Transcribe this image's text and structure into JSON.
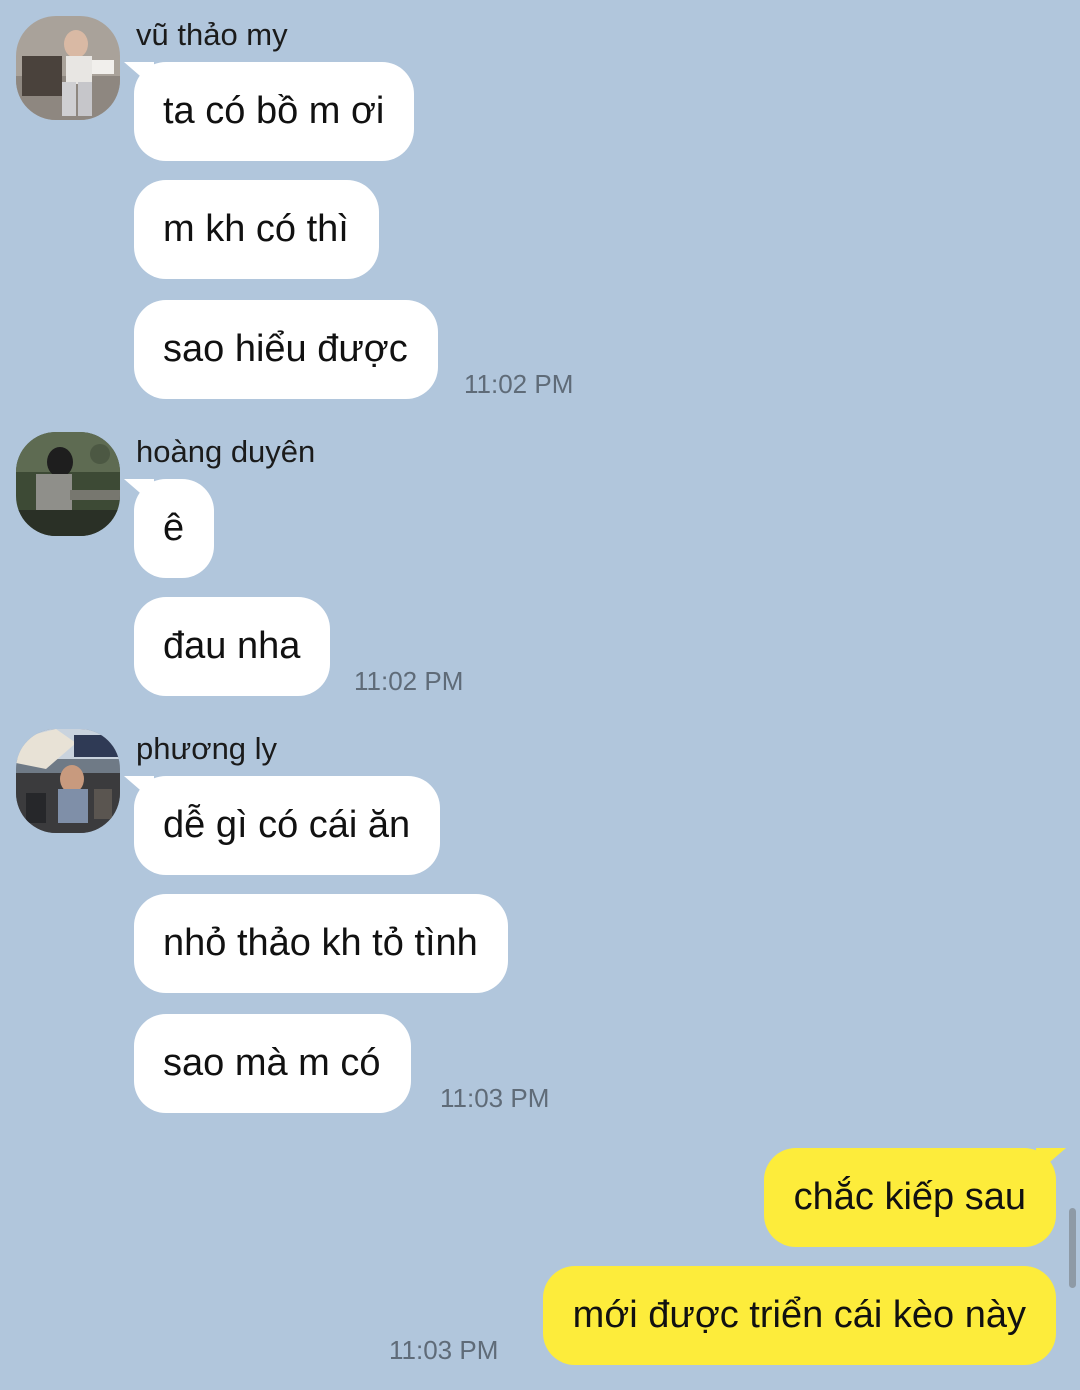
{
  "colors": {
    "background": "#b1c6dc",
    "incoming_bubble": "#ffffff",
    "outgoing_bubble": "#fdec3b",
    "timestamp": "#5f6b78"
  },
  "groups": [
    {
      "sender": "vũ thảo my",
      "messages": [
        "ta có bồ m ơi",
        "m kh có thì",
        "sao hiểu được"
      ],
      "time": "11:02 PM"
    },
    {
      "sender": "hoàng duyên",
      "messages": [
        "ê",
        "đau nha"
      ],
      "time": "11:02 PM"
    },
    {
      "sender": "phương ly",
      "messages": [
        "dễ gì có cái ăn",
        "nhỏ thảo kh tỏ tình",
        "sao mà m có"
      ],
      "time": "11:03 PM"
    }
  ],
  "outgoing": {
    "messages": [
      "chắc kiếp sau",
      "mới được triển cái kèo này"
    ],
    "time": "11:03 PM"
  }
}
